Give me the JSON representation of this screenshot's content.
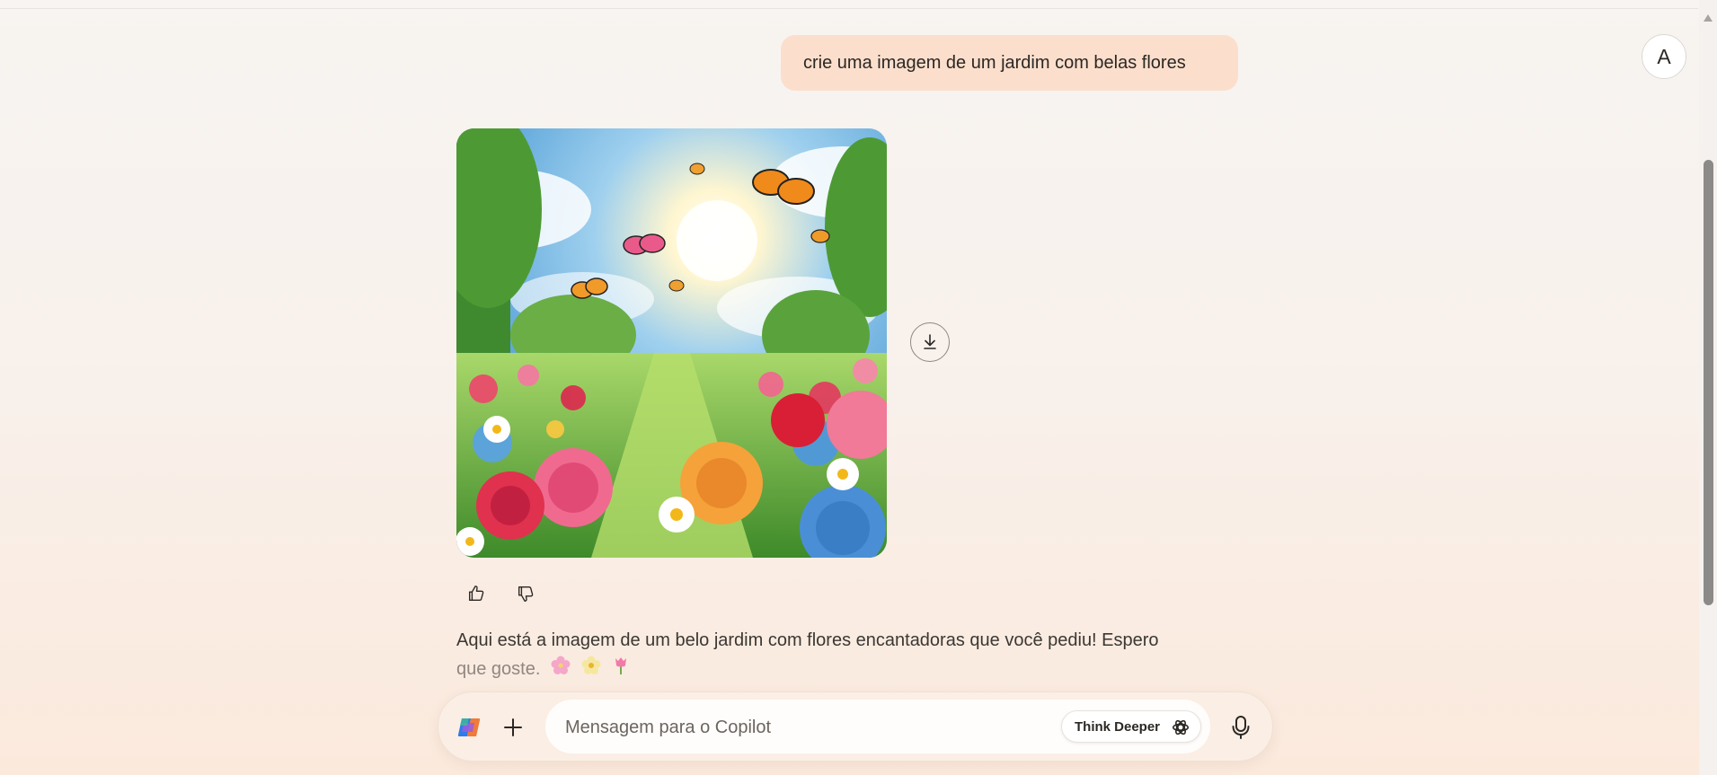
{
  "user": {
    "avatar_initial": "A"
  },
  "conversation": {
    "user_message": "crie uma imagem de um jardim com belas flores",
    "assistant_image": {
      "alt": "jardim com belas flores"
    },
    "assistant_reply_line1": "Aqui está a imagem de um belo jardim com flores encantadoras que você pediu! Espero",
    "assistant_reply_line2": "que goste.",
    "reply_emojis": [
      "🌸",
      "🌼",
      "🌷"
    ]
  },
  "composer": {
    "placeholder": "Mensagem para o Copilot",
    "think_deeper_label": "Think Deeper"
  },
  "icons": {
    "download": "download-icon",
    "like": "thumbs-up-icon",
    "dislike": "thumbs-down-icon",
    "logo": "copilot-logo-icon",
    "plus": "plus-icon",
    "think": "think-deeper-icon",
    "mic": "microphone-icon"
  },
  "colors": {
    "user_bubble": "#fbdfcc",
    "background": "#f7f4f1"
  }
}
